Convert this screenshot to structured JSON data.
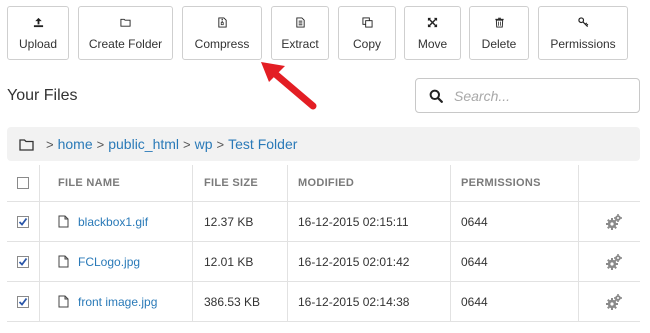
{
  "toolbar": {
    "buttons": [
      {
        "label": "Upload",
        "icon": "upload-icon"
      },
      {
        "label": "Create Folder",
        "icon": "folder-icon"
      },
      {
        "label": "Compress",
        "icon": "file-zip-icon"
      },
      {
        "label": "Extract",
        "icon": "file-extract-icon"
      },
      {
        "label": "Copy",
        "icon": "copy-icon"
      },
      {
        "label": "Move",
        "icon": "move-arrows-icon"
      },
      {
        "label": "Delete",
        "icon": "trash-icon"
      },
      {
        "label": "Permissions",
        "icon": "key-icon"
      }
    ]
  },
  "annotation": {
    "icon": "red-arrow-icon",
    "color": "#e31e24"
  },
  "page": {
    "title": "Your Files"
  },
  "search": {
    "placeholder": "Search..."
  },
  "breadcrumb": {
    "separator": ">",
    "items": [
      "home",
      "public_html",
      "wp",
      "Test Folder"
    ]
  },
  "table": {
    "headers": {
      "name": "File Name",
      "size": "File Size",
      "modified": "Modified",
      "permissions": "Permissions"
    },
    "rows": [
      {
        "name": "blackbox1.gif",
        "size": "12.37 KB",
        "modified": "16-12-2015 02:15:11",
        "permissions": "0644",
        "checked": true
      },
      {
        "name": "FCLogo.jpg",
        "size": "12.01 KB",
        "modified": "16-12-2015 02:01:42",
        "permissions": "0644",
        "checked": true
      },
      {
        "name": "front image.jpg",
        "size": "386.53 KB",
        "modified": "16-12-2015 02:14:38",
        "permissions": "0644",
        "checked": true
      }
    ]
  },
  "colors": {
    "link": "#2a7ab8",
    "border": "#cfcfcf",
    "breadcrumb_bg": "#f2f2f2",
    "header_text": "#7a7a7a"
  }
}
